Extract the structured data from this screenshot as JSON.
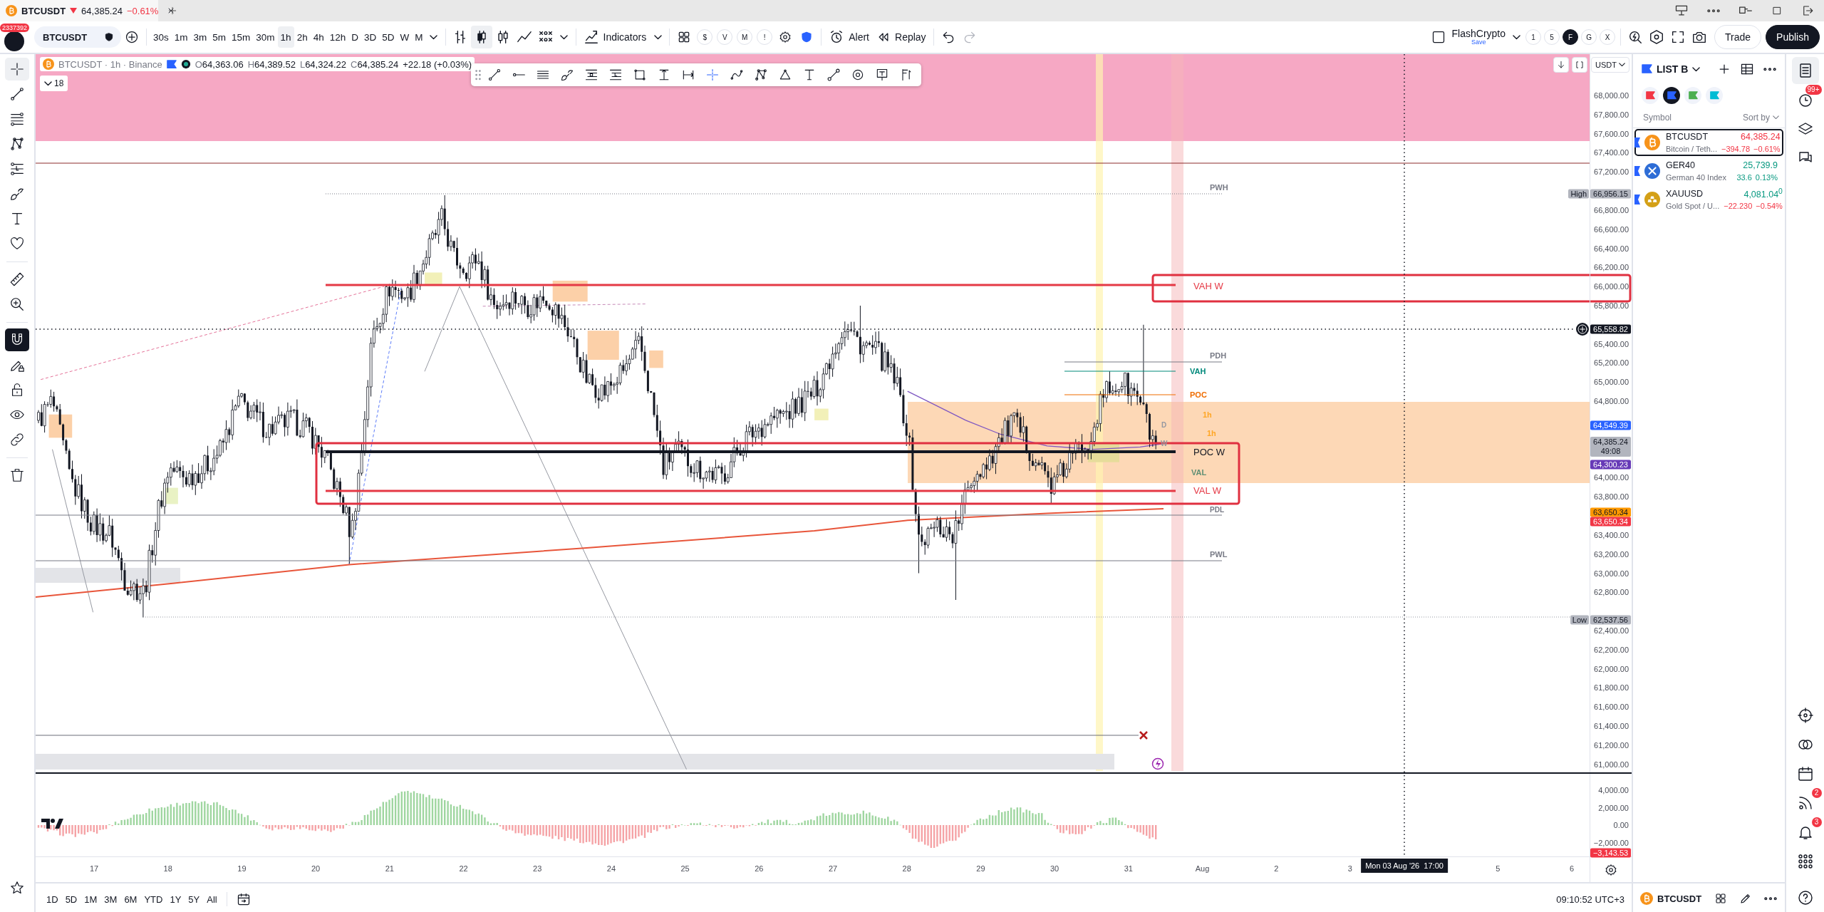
{
  "browser_tab": {
    "symbol": "BTCUSDT",
    "rising": false,
    "price": "64,385.24",
    "change": "−0.61%"
  },
  "toolbar": {
    "user_badge": "2337392",
    "symbol": "BTCUSDT",
    "intervals": [
      {
        "label": "30s",
        "selected": false
      },
      {
        "label": "1m",
        "selected": false
      },
      {
        "label": "3m",
        "selected": false
      },
      {
        "label": "5m",
        "selected": false
      },
      {
        "label": "15m",
        "selected": false
      },
      {
        "label": "30m",
        "selected": false
      },
      {
        "label": "1h",
        "selected": true
      },
      {
        "label": "2h",
        "selected": false
      },
      {
        "label": "4h",
        "selected": false
      },
      {
        "label": "12h",
        "selected": false
      },
      {
        "label": "D",
        "selected": false
      },
      {
        "label": "3D",
        "selected": false
      },
      {
        "label": "5D",
        "selected": false
      },
      {
        "label": "W",
        "selected": false
      },
      {
        "label": "M",
        "selected": false
      }
    ],
    "chart_types": [
      {
        "kind": "bars",
        "selected": false
      },
      {
        "kind": "candles",
        "selected": true
      },
      {
        "kind": "hollow",
        "selected": false
      },
      {
        "kind": "line",
        "selected": false
      },
      {
        "kind": "pointfigure",
        "selected": false
      }
    ],
    "indicators": "Indicators",
    "quick_buttons": [
      "$",
      "V",
      "M",
      "!"
    ],
    "alert": "Alert",
    "replay": "Replay",
    "layout_name": "FlashCrypto",
    "layout_status": "Save",
    "layout_slots": [
      {
        "label": "1",
        "selected": false
      },
      {
        "label": "5",
        "selected": false
      },
      {
        "label": "F",
        "selected": true
      },
      {
        "label": "G",
        "selected": false
      },
      {
        "label": "X",
        "selected": false
      }
    ],
    "trade": "Trade",
    "publish": "Publish"
  },
  "drawing_tools": [
    {
      "kind": "crosshair",
      "selected": true
    },
    {
      "kind": "trendline",
      "selected": false
    },
    {
      "kind": "fib",
      "selected": false
    },
    {
      "kind": "pattern",
      "selected": false
    },
    {
      "kind": "position",
      "selected": false
    },
    {
      "kind": "brush",
      "selected": false
    },
    {
      "kind": "text",
      "selected": false
    },
    {
      "kind": "heart",
      "selected": false
    },
    {
      "kind": "ruler",
      "selected": false
    },
    {
      "kind": "zoom",
      "selected": false
    },
    {
      "kind": "magnet",
      "on": true
    },
    {
      "kind": "drawlock",
      "on": false
    },
    {
      "kind": "lock",
      "on": false
    },
    {
      "kind": "eye",
      "on": false
    },
    {
      "kind": "link",
      "on": false
    },
    {
      "kind": "trash",
      "selected": false
    }
  ],
  "chart": {
    "legend": {
      "title": "BTCUSDT · 1h · Binance",
      "ohlc": [
        {
          "key": "O",
          "value": "64,363.06"
        },
        {
          "key": "H",
          "value": "64,389.52"
        },
        {
          "key": "L",
          "value": "64,324.22"
        },
        {
          "key": "C",
          "value": "64,385.24"
        }
      ],
      "change": "+22.18 (+0.03%)",
      "indicator_count": "18"
    },
    "floating_toolbar": [
      {
        "kind": "trendline",
        "selected": false
      },
      {
        "kind": "ray",
        "selected": false
      },
      {
        "kind": "channel",
        "selected": false
      },
      {
        "kind": "brush",
        "selected": false
      },
      {
        "kind": "fibs",
        "selected": false
      },
      {
        "kind": "fibl",
        "selected": false
      },
      {
        "kind": "rectangle",
        "selected": false
      },
      {
        "kind": "pricerange",
        "selected": false
      },
      {
        "kind": "daterange",
        "selected": false
      },
      {
        "kind": "crossline",
        "selected": true
      },
      {
        "kind": "path",
        "selected": false
      },
      {
        "kind": "pattern",
        "selected": false
      },
      {
        "kind": "triangle",
        "selected": false
      },
      {
        "kind": "text",
        "selected": false
      },
      {
        "kind": "nodes",
        "selected": false
      },
      {
        "kind": "target",
        "selected": false
      },
      {
        "kind": "note",
        "selected": false
      },
      {
        "kind": "flagpole",
        "selected": false
      }
    ],
    "currency": "USDT",
    "price_axis": [
      "68,000.00",
      "67,800.00",
      "67,600.00",
      "67,400.00",
      "67,200.00",
      "66,800.00",
      "66,600.00",
      "66,400.00",
      "66,200.00",
      "66,000.00",
      "65,800.00",
      "65,400.00",
      "65,200.00",
      "65,000.00",
      "64,800.00",
      "64,000.00",
      "63,800.00",
      "63,400.00",
      "63,200.00",
      "63,000.00",
      "62,800.00",
      "62,400.00",
      "62,200.00",
      "62,000.00",
      "61,800.00",
      "61,600.00",
      "61,400.00",
      "61,200.00",
      "61,000.00"
    ],
    "price_badges": [
      {
        "kind": "extreme",
        "tag": "High",
        "value": "66,956.15",
        "color": "#b2b5be"
      },
      {
        "kind": "crosshair",
        "value": "65,558.82",
        "color": "#131722"
      },
      {
        "kind": "level",
        "value": "64,549.39",
        "color": "#2962ff"
      },
      {
        "kind": "last",
        "value": "64,385.24",
        "countdown": "49:08",
        "color": "#b2b5be"
      },
      {
        "kind": "level",
        "value": "64,300.23",
        "color": "#673ab7"
      },
      {
        "kind": "level",
        "value": "63,650.34",
        "color": "#ff9800"
      },
      {
        "kind": "level",
        "value": "63,650.34",
        "color": "#f23645"
      },
      {
        "kind": "extreme",
        "tag": "Low",
        "value": "62,537.56",
        "color": "#b2b5be"
      }
    ],
    "level_labels": [
      {
        "text": "PWH",
        "color": "#787b86"
      },
      {
        "text": "VAH W",
        "color": "#e53945"
      },
      {
        "text": "PDH",
        "color": "#787b86"
      },
      {
        "text": "VAH",
        "color": "#00897b"
      },
      {
        "text": "POC",
        "color": "#ef6c00"
      },
      {
        "text": "1h",
        "color": "#ffa726"
      },
      {
        "text": "D",
        "color": "#9598a1"
      },
      {
        "text": "1h",
        "color": "#ffa726"
      },
      {
        "text": "W",
        "color": "#9598a1"
      },
      {
        "text": "POC W",
        "color": "#131722"
      },
      {
        "text": "VAL",
        "color": "#5f8f74"
      },
      {
        "text": "VAL W",
        "color": "#e53945"
      },
      {
        "text": "PDL",
        "color": "#787b86"
      },
      {
        "text": "PWL",
        "color": "#787b86"
      }
    ],
    "oscillator_axis": [
      "4,000.00",
      "2,000.00",
      "0.00",
      "−2,000.00"
    ],
    "oscillator_badge": {
      "value": "−3,143.53",
      "color": "#f23645"
    },
    "time_axis": [
      "17",
      "18",
      "19",
      "20",
      "21",
      "22",
      "23",
      "24",
      "25",
      "26",
      "27",
      "28",
      "29",
      "30",
      "31",
      "Aug",
      "2",
      "3",
      "5",
      "6"
    ],
    "crosshair_time": "Mon 03 Aug '26  17:00"
  },
  "bottom_bar": {
    "ranges": [
      "1D",
      "5D",
      "1M",
      "3M",
      "6M",
      "YTD",
      "1Y",
      "5Y",
      "All"
    ],
    "clock": "09:10:52 UTC+3"
  },
  "watchlist": {
    "title": "LIST B",
    "flags": [
      {
        "color": "#f23645",
        "selected": false
      },
      {
        "color": "#2962ff",
        "selected": true
      },
      {
        "color": "#4caf50",
        "selected": false
      },
      {
        "color": "#00bcd4",
        "selected": false
      }
    ],
    "columns": [
      "Symbol",
      "Sort by"
    ],
    "rows": [
      {
        "kind": "crypto",
        "symbol": "BTCUSDT",
        "name": "Bitcoin / Teth...",
        "price": "64,385.24",
        "change": "−394.78",
        "percent": "−0.61%",
        "price_rising": false,
        "change_rising": false,
        "selected": true
      },
      {
        "kind": "index",
        "symbol": "GER40",
        "name": "German 40 Index",
        "price": "25,739.9",
        "change": "33.6",
        "percent": "0.13%",
        "price_rising": true,
        "change_rising": true,
        "selected": false
      },
      {
        "kind": "metal",
        "symbol": "XAUUSD",
        "name": "Gold Spot / U...",
        "price": "4,081.04$^{0}$",
        "change": "−22.230",
        "percent": "−0.54%",
        "price_rising": true,
        "change_rising": false,
        "selected": false
      }
    ],
    "footer_symbol": "BTCUSDT"
  },
  "right_rail": {
    "top": [
      {
        "kind": "watchlist",
        "selected": true
      },
      {
        "kind": "alerts",
        "badge": "99+",
        "selected": false
      },
      {
        "kind": "layers",
        "selected": false
      },
      {
        "kind": "chat",
        "selected": false
      }
    ],
    "bottom": [
      {
        "kind": "target",
        "selected": false
      },
      {
        "kind": "circles",
        "selected": false
      },
      {
        "kind": "calendar",
        "selected": false
      },
      {
        "kind": "broadcast",
        "badge": "2",
        "selected": false
      },
      {
        "kind": "bell",
        "badge": "3",
        "selected": false
      },
      {
        "kind": "apps",
        "selected": false
      }
    ]
  }
}
